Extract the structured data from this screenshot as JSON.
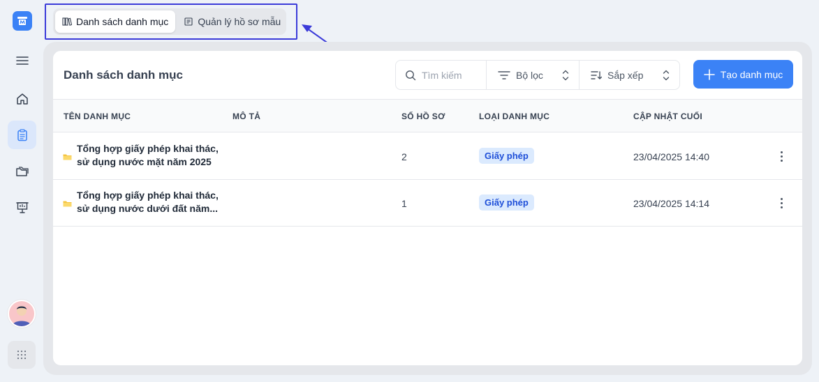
{
  "tabs": [
    {
      "label": "Danh sách danh mục",
      "icon": "books-icon",
      "active": true
    },
    {
      "label": "Quản lý hồ sơ mẫu",
      "icon": "document-icon",
      "active": false
    }
  ],
  "sidebar": {
    "items": [
      {
        "icon": "menu-icon"
      },
      {
        "icon": "home-icon"
      },
      {
        "icon": "clipboard-icon",
        "active": true
      },
      {
        "icon": "folders-icon"
      },
      {
        "icon": "presentation-icon"
      }
    ]
  },
  "page": {
    "title": "Danh sách danh mục",
    "search_placeholder": "Tìm kiếm",
    "filter_label": "Bộ lọc",
    "sort_label": "Sắp xếp",
    "create_label": "Tạo danh mục"
  },
  "table": {
    "columns": [
      "TÊN DANH MỤC",
      "MÔ TẢ",
      "SỐ HỒ SƠ",
      "LOẠI DANH MỤC",
      "CẬP NHẬT CUỐI"
    ],
    "rows": [
      {
        "name": "Tổng hợp giấy phép khai thác, sử dụng nước mặt năm 2025",
        "description": "",
        "count": "2",
        "type": "Giấy phép",
        "updated": "23/04/2025 14:40"
      },
      {
        "name": "Tổng hợp giấy phép khai thác, sử dụng nước dưới đất năm...",
        "description": "",
        "count": "1",
        "type": "Giấy phép",
        "updated": "23/04/2025 14:14"
      }
    ]
  },
  "colors": {
    "accent": "#3b82f6",
    "highlight_box": "#3b3bd9",
    "badge_bg": "#dbeafe",
    "badge_text": "#1d4ed8"
  }
}
